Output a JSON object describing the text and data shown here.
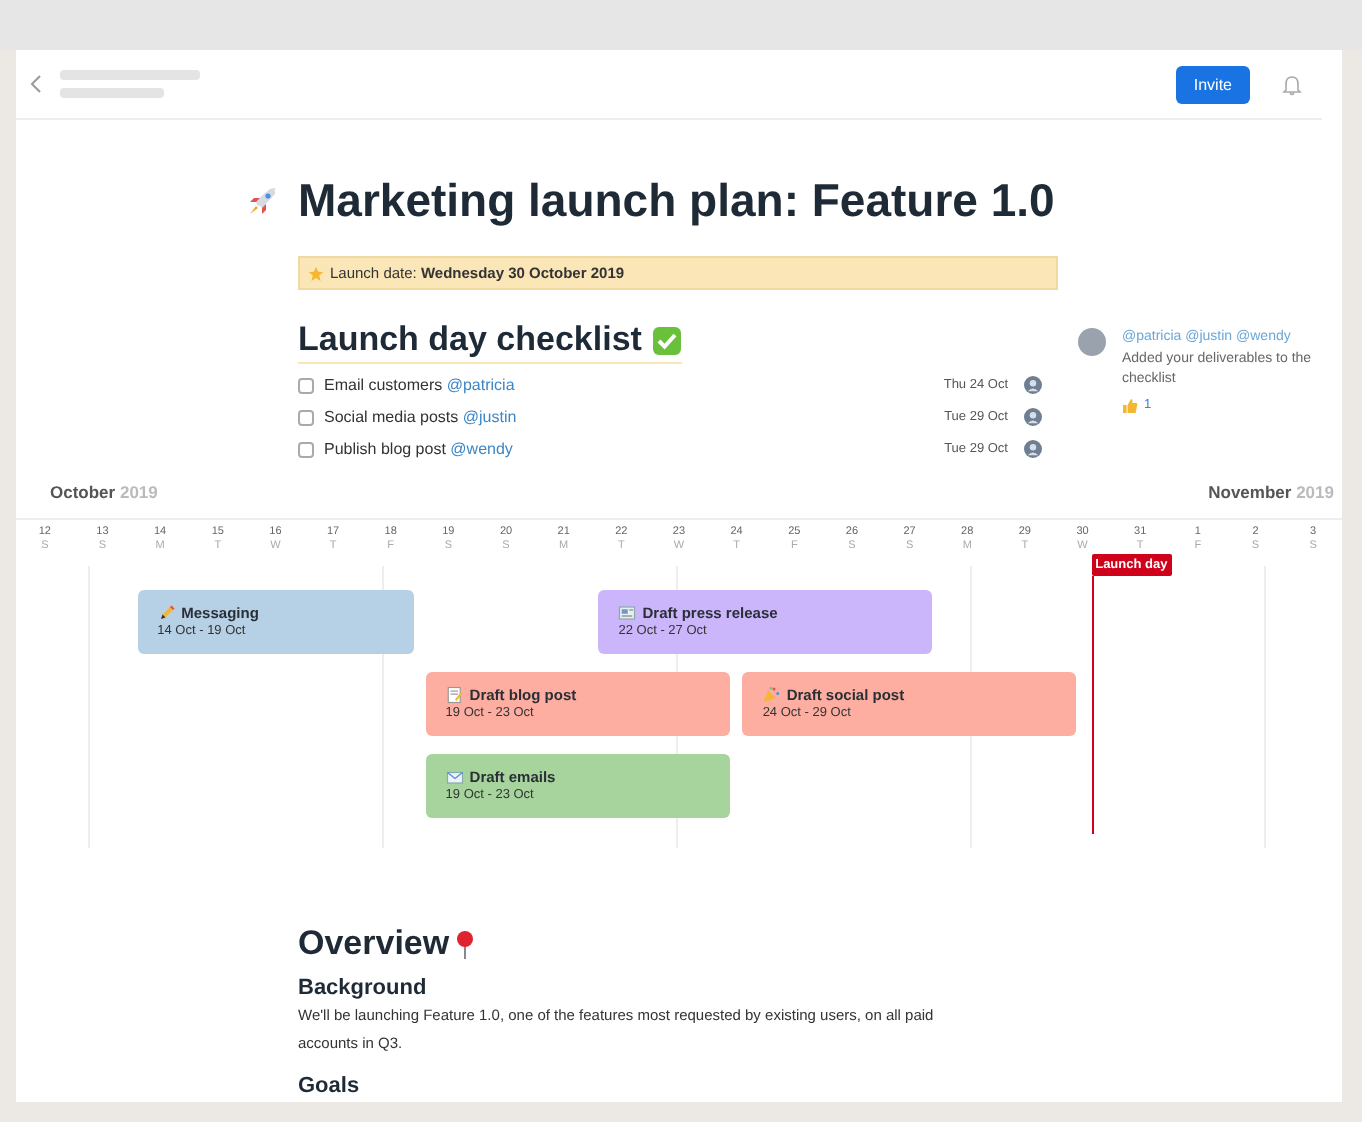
{
  "header": {
    "invite_button": "Invite"
  },
  "title": "Marketing launch plan: Feature 1.0",
  "banner": {
    "text": "Launch date: **Wednesday 30 October 2019**"
  },
  "checklist": {
    "heading": "Launch day checklist",
    "items": [
      {
        "text": "Email customers",
        "mention": "@patricia",
        "date": "Thu 24 Oct",
        "checked": false
      },
      {
        "text": "Social media posts",
        "mention": "@justin",
        "date": "Tue 29 Oct",
        "checked": false
      },
      {
        "text": "Publish blog post",
        "mention": "@wendy",
        "date": "Tue 29 Oct",
        "checked": false
      }
    ]
  },
  "comment": {
    "mentions": "@patricia @justin @wendy",
    "text": "Added your deliverables to the checklist",
    "likes": "1"
  },
  "timeline": {
    "months": [
      {
        "name": "October",
        "year": "2019"
      },
      {
        "name": "November",
        "year": "2019"
      }
    ],
    "days": [
      {
        "date": "12",
        "weekday": "S"
      },
      {
        "date": "13",
        "weekday": "S"
      },
      {
        "date": "14",
        "weekday": "M"
      },
      {
        "date": "15",
        "weekday": "T"
      },
      {
        "date": "16",
        "weekday": "W"
      },
      {
        "date": "17",
        "weekday": "T"
      },
      {
        "date": "18",
        "weekday": "F"
      },
      {
        "date": "19",
        "weekday": "S"
      },
      {
        "date": "20",
        "weekday": "S"
      },
      {
        "date": "21",
        "weekday": "M"
      },
      {
        "date": "22",
        "weekday": "T"
      },
      {
        "date": "23",
        "weekday": "W"
      },
      {
        "date": "24",
        "weekday": "T"
      },
      {
        "date": "25",
        "weekday": "F"
      },
      {
        "date": "26",
        "weekday": "S"
      },
      {
        "date": "27",
        "weekday": "S"
      },
      {
        "date": "28",
        "weekday": "M"
      },
      {
        "date": "29",
        "weekday": "T"
      },
      {
        "date": "30",
        "weekday": "W"
      },
      {
        "date": "31",
        "weekday": "T"
      },
      {
        "date": "1",
        "weekday": "F"
      },
      {
        "date": "2",
        "weekday": "S"
      },
      {
        "date": "3",
        "weekday": "S"
      }
    ],
    "bars": [
      {
        "title": "Messaging",
        "dates": "14 Oct - 19 Oct",
        "color": "#b6d0e5"
      },
      {
        "title": "Draft press release",
        "dates": "22 Oct - 27 Oct",
        "color": "#cbb5fb"
      },
      {
        "title": "Draft blog post",
        "dates": "19 Oct - 23 Oct",
        "color": "#fdaea0"
      },
      {
        "title": "Draft social post",
        "dates": "24 Oct - 29 Oct",
        "color": "#fdaea0"
      },
      {
        "title": "Draft emails",
        "dates": "19 Oct - 23 Oct",
        "color": "#a6d49c"
      }
    ],
    "marker": "Launch day"
  },
  "overview": {
    "heading": "Overview",
    "sections": [
      {
        "heading": "Background",
        "text": "We'll be launching Feature 1.0, one of the features most requested by existing users, on all paid accounts in Q3."
      },
      {
        "heading": "Goals"
      }
    ]
  }
}
